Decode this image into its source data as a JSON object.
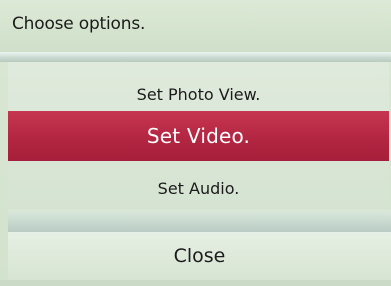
{
  "header": {
    "title": "Choose options."
  },
  "menu": {
    "items": [
      {
        "label": "Set Photo View.",
        "selected": false
      },
      {
        "label": "Set Video.",
        "selected": true
      },
      {
        "label": "Set Audio.",
        "selected": false
      }
    ]
  },
  "footer": {
    "close_label": "Close"
  },
  "colors": {
    "background": "#d9e7d3",
    "highlight": "#b32642",
    "highlight_text": "#ffffff",
    "text": "#1b1b1b"
  }
}
